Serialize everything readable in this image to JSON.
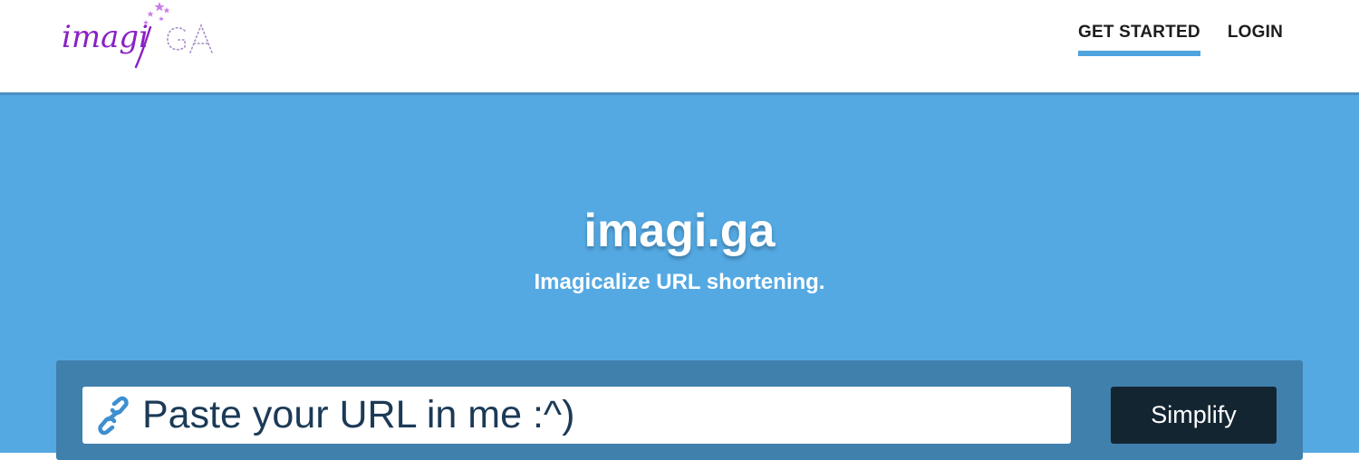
{
  "brand": {
    "logo_main": "imagi",
    "logo_suffix": "GA",
    "logo_color": "#8a21c4",
    "star_color": "#c77be8"
  },
  "nav": {
    "items": [
      {
        "label": "GET STARTED",
        "active": true
      },
      {
        "label": "LOGIN",
        "active": false
      }
    ],
    "active_color": "#4ea4de"
  },
  "hero": {
    "title": "imagi.ga",
    "subtitle": "Imagicalize URL shortening.",
    "background": "#54a9e3"
  },
  "shortener": {
    "url_placeholder": "Paste your URL in me :^)",
    "url_value": "",
    "link_icon": "link-icon",
    "submit_label": "Simplify",
    "panel_color": "#4080ad",
    "button_color": "#142532"
  }
}
